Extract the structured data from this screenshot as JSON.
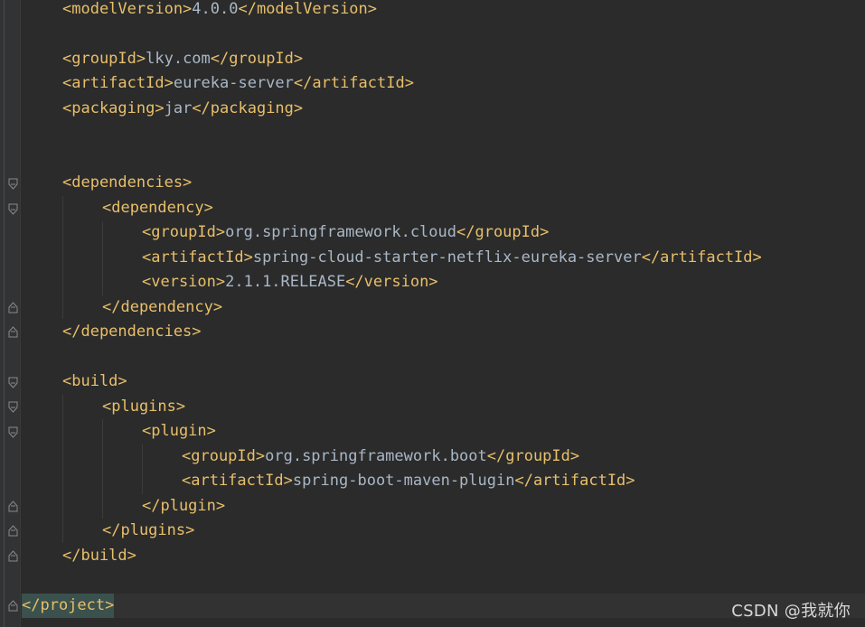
{
  "editor": {
    "lines": [
      {
        "open": "<modelVersion>",
        "text": "4.0.0",
        "close": "</modelVersion>"
      },
      {
        "open": "<groupId>",
        "text": "lky.com",
        "close": "</groupId>"
      },
      {
        "open": "<artifactId>",
        "text": "eureka-server",
        "close": "</artifactId>"
      },
      {
        "open": "<packaging>",
        "text": "jar",
        "close": "</packaging>"
      },
      {
        "open": "<dependencies>"
      },
      {
        "open": "<dependency>"
      },
      {
        "open": "<groupId>",
        "text": "org.springframework.cloud",
        "close": "</groupId>"
      },
      {
        "open": "<artifactId>",
        "text": "spring-cloud-starter-netflix-eureka-server",
        "close": "</artifactId>"
      },
      {
        "open": "<version>",
        "text": "2.1.1.RELEASE",
        "close": "</version>"
      },
      {
        "open": "</dependency>"
      },
      {
        "open": "</dependencies>"
      },
      {
        "open": "<build>"
      },
      {
        "open": "<plugins>"
      },
      {
        "open": "<plugin>"
      },
      {
        "open": "<groupId>",
        "text": "org.springframework.boot",
        "close": "</groupId>"
      },
      {
        "open": "<artifactId>",
        "text": "spring-boot-maven-plugin",
        "close": "</artifactId>"
      },
      {
        "open": "</plugin>"
      },
      {
        "open": "</plugins>"
      },
      {
        "open": "</build>"
      },
      {
        "open": "</project>"
      }
    ]
  },
  "watermark": "CSDN @我就你",
  "colors": {
    "background": "#2b2b2b",
    "tag": "#e8bf6a",
    "text": "#a9b7c6",
    "current_line": "#323232",
    "match_highlight": "#3b514d"
  }
}
